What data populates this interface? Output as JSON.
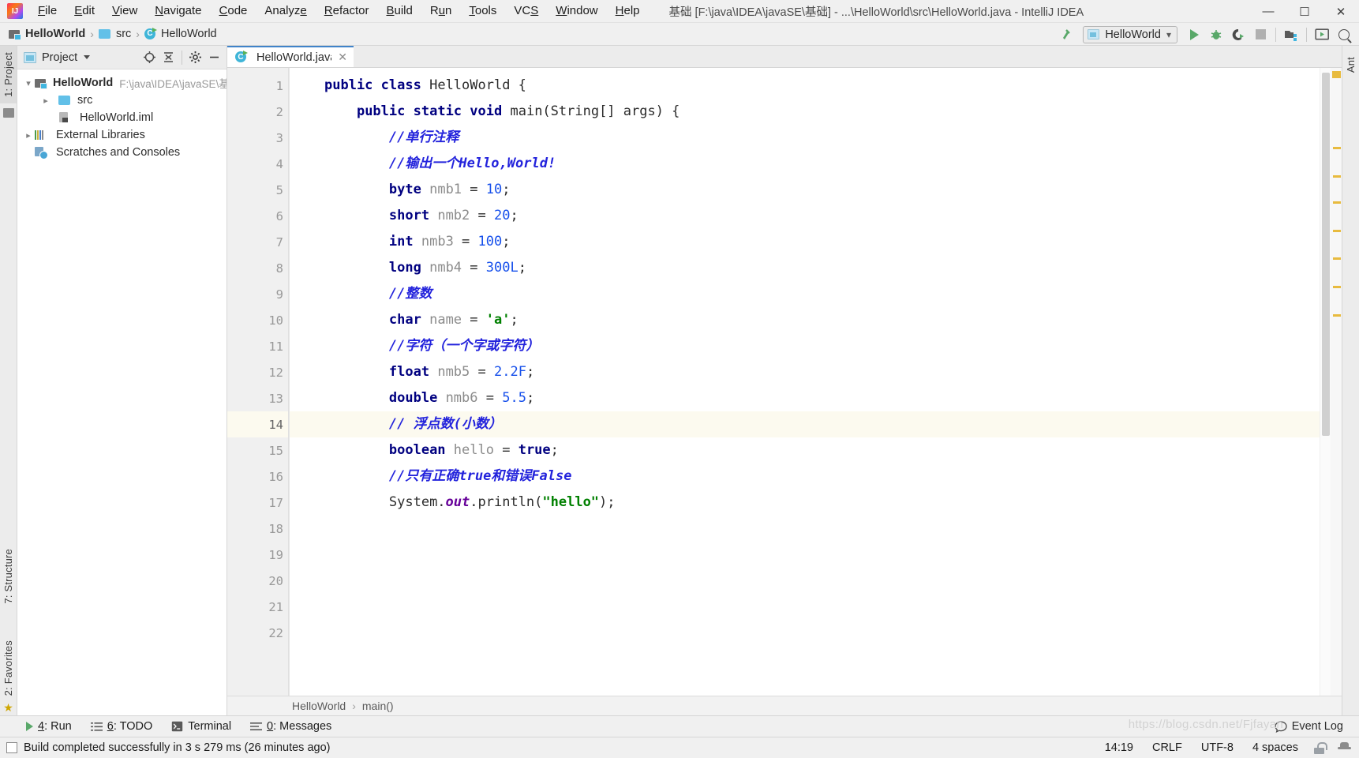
{
  "window": {
    "title": "基础 [F:\\java\\IDEA\\javaSE\\基础] - ...\\HelloWorld\\src\\HelloWorld.java - IntelliJ IDEA",
    "minimize": "—",
    "maximize": "☐",
    "close": "✕"
  },
  "menu": [
    {
      "label": "File"
    },
    {
      "label": "Edit"
    },
    {
      "label": "View"
    },
    {
      "label": "Navigate"
    },
    {
      "label": "Code"
    },
    {
      "label": "Analyze"
    },
    {
      "label": "Refactor"
    },
    {
      "label": "Build"
    },
    {
      "label": "Run"
    },
    {
      "label": "Tools"
    },
    {
      "label": "VCS"
    },
    {
      "label": "Window"
    },
    {
      "label": "Help"
    }
  ],
  "navbar": {
    "crumbs": [
      "HelloWorld",
      "src",
      "HelloWorld"
    ],
    "run_config": "HelloWorld",
    "sep": "›"
  },
  "left_strip": {
    "project_tab": "1: Project",
    "structure_tab": "7: Structure",
    "favorites_tab": "2: Favorites"
  },
  "right_strip": {
    "ant_tab": "Ant"
  },
  "project_panel": {
    "title": "Project",
    "tree": [
      {
        "label": "HelloWorld",
        "path": "F:\\java\\IDEA\\javaSE\\基",
        "icon": "module-icon",
        "arrow": "open",
        "indent": 0,
        "bold": true
      },
      {
        "label": "src",
        "path": "",
        "icon": "folder-icon",
        "arrow": "closed",
        "indent": 1,
        "bold": false
      },
      {
        "label": "HelloWorld.iml",
        "path": "",
        "icon": "iml-file-icon",
        "arrow": "none",
        "indent": 1,
        "bold": false
      },
      {
        "label": "External Libraries",
        "path": "",
        "icon": "library-icon",
        "arrow": "closed",
        "indent": 0,
        "bold": false
      },
      {
        "label": "Scratches and Consoles",
        "path": "",
        "icon": "scratches-icon",
        "arrow": "none",
        "indent": 0,
        "bold": false
      }
    ]
  },
  "editor": {
    "tab": {
      "name": "HelloWorld.java",
      "close": "✕"
    },
    "line_numbers": [
      "1",
      "2",
      "3",
      "4",
      "5",
      "6",
      "7",
      "8",
      "9",
      "10",
      "11",
      "12",
      "13",
      "14",
      "15",
      "16",
      "17",
      "18",
      "19",
      "20",
      "21",
      "22"
    ],
    "current_line": 14,
    "breadcrumb": [
      "HelloWorld",
      "main()"
    ],
    "code": [
      {
        "n": 1,
        "tokens": [
          {
            "t": "public",
            "c": "kw"
          },
          {
            "t": " ",
            "c": "plain"
          },
          {
            "t": "class",
            "c": "kw"
          },
          {
            "t": " HelloWorld {",
            "c": "plain"
          }
        ]
      },
      {
        "n": 2,
        "tokens": [
          {
            "t": "    ",
            "c": "plain"
          },
          {
            "t": "public",
            "c": "kw"
          },
          {
            "t": " ",
            "c": "plain"
          },
          {
            "t": "static",
            "c": "kw"
          },
          {
            "t": " ",
            "c": "plain"
          },
          {
            "t": "void",
            "c": "kw"
          },
          {
            "t": " main(String[] args) {",
            "c": "plain"
          }
        ]
      },
      {
        "n": 3,
        "tokens": [
          {
            "t": "        ",
            "c": "plain"
          },
          {
            "t": "//单行注释",
            "c": "cmt"
          }
        ]
      },
      {
        "n": 4,
        "tokens": [
          {
            "t": "        ",
            "c": "plain"
          },
          {
            "t": "//输出一个Hello,World!",
            "c": "cmt"
          }
        ]
      },
      {
        "n": 5,
        "tokens": [
          {
            "t": "        ",
            "c": "plain"
          },
          {
            "t": "byte",
            "c": "kw"
          },
          {
            "t": " ",
            "c": "plain"
          },
          {
            "t": "nmb1",
            "c": "var"
          },
          {
            "t": " = ",
            "c": "plain"
          },
          {
            "t": "10",
            "c": "num"
          },
          {
            "t": ";",
            "c": "plain"
          }
        ]
      },
      {
        "n": 6,
        "tokens": [
          {
            "t": "        ",
            "c": "plain"
          },
          {
            "t": "short",
            "c": "kw"
          },
          {
            "t": " ",
            "c": "plain"
          },
          {
            "t": "nmb2",
            "c": "var"
          },
          {
            "t": " = ",
            "c": "plain"
          },
          {
            "t": "20",
            "c": "num"
          },
          {
            "t": ";",
            "c": "plain"
          }
        ]
      },
      {
        "n": 7,
        "tokens": [
          {
            "t": "        ",
            "c": "plain"
          },
          {
            "t": "int",
            "c": "kw"
          },
          {
            "t": " ",
            "c": "plain"
          },
          {
            "t": "nmb3",
            "c": "var"
          },
          {
            "t": " = ",
            "c": "plain"
          },
          {
            "t": "100",
            "c": "num"
          },
          {
            "t": ";",
            "c": "plain"
          }
        ]
      },
      {
        "n": 8,
        "tokens": [
          {
            "t": "        ",
            "c": "plain"
          },
          {
            "t": "long",
            "c": "kw"
          },
          {
            "t": " ",
            "c": "plain"
          },
          {
            "t": "nmb4",
            "c": "var"
          },
          {
            "t": " = ",
            "c": "plain"
          },
          {
            "t": "300L",
            "c": "num"
          },
          {
            "t": ";",
            "c": "plain"
          }
        ]
      },
      {
        "n": 9,
        "tokens": [
          {
            "t": "        ",
            "c": "plain"
          },
          {
            "t": "//整数",
            "c": "cmt"
          }
        ]
      },
      {
        "n": 10,
        "tokens": [
          {
            "t": "        ",
            "c": "plain"
          },
          {
            "t": "char",
            "c": "kw"
          },
          {
            "t": " ",
            "c": "plain"
          },
          {
            "t": "name",
            "c": "var"
          },
          {
            "t": " = ",
            "c": "plain"
          },
          {
            "t": "'a'",
            "c": "str"
          },
          {
            "t": ";",
            "c": "plain"
          }
        ]
      },
      {
        "n": 11,
        "tokens": [
          {
            "t": "        ",
            "c": "plain"
          },
          {
            "t": "//字符（一个字或字符）",
            "c": "cmt"
          }
        ]
      },
      {
        "n": 12,
        "tokens": [
          {
            "t": "        ",
            "c": "plain"
          },
          {
            "t": "float",
            "c": "kw"
          },
          {
            "t": " ",
            "c": "plain"
          },
          {
            "t": "nmb5",
            "c": "var"
          },
          {
            "t": " = ",
            "c": "plain"
          },
          {
            "t": "2.2F",
            "c": "num"
          },
          {
            "t": ";",
            "c": "plain"
          }
        ]
      },
      {
        "n": 13,
        "tokens": [
          {
            "t": "        ",
            "c": "plain"
          },
          {
            "t": "double",
            "c": "kw"
          },
          {
            "t": " ",
            "c": "plain"
          },
          {
            "t": "nmb6",
            "c": "var"
          },
          {
            "t": " = ",
            "c": "plain"
          },
          {
            "t": "5.5",
            "c": "num"
          },
          {
            "t": ";",
            "c": "plain"
          }
        ]
      },
      {
        "n": 14,
        "tokens": [
          {
            "t": "        ",
            "c": "plain"
          },
          {
            "t": "// 浮点数(小数）",
            "c": "cmt"
          }
        ]
      },
      {
        "n": 15,
        "tokens": [
          {
            "t": "        ",
            "c": "plain"
          },
          {
            "t": "boolean",
            "c": "kw"
          },
          {
            "t": " ",
            "c": "plain"
          },
          {
            "t": "hello",
            "c": "var"
          },
          {
            "t": " = ",
            "c": "plain"
          },
          {
            "t": "true",
            "c": "kw"
          },
          {
            "t": ";",
            "c": "plain"
          }
        ]
      },
      {
        "n": 16,
        "tokens": [
          {
            "t": "        ",
            "c": "plain"
          },
          {
            "t": "//只有正确true和错误False",
            "c": "cmt"
          }
        ]
      },
      {
        "n": 17,
        "tokens": [
          {
            "t": "        ",
            "c": "plain"
          },
          {
            "t": "System.",
            "c": "plain"
          },
          {
            "t": "out",
            "c": "fld"
          },
          {
            "t": ".println(",
            "c": "plain"
          },
          {
            "t": "\"hello\"",
            "c": "str"
          },
          {
            "t": ");",
            "c": "plain"
          }
        ]
      },
      {
        "n": 18,
        "tokens": []
      },
      {
        "n": 19,
        "tokens": []
      },
      {
        "n": 20,
        "tokens": []
      },
      {
        "n": 21,
        "tokens": []
      },
      {
        "n": 22,
        "tokens": []
      }
    ]
  },
  "bottom_tools": [
    {
      "num": "4",
      "label": ": Run",
      "icon": "run-icon"
    },
    {
      "num": "6",
      "label": ": TODO",
      "icon": "todo-icon"
    },
    {
      "num": "",
      "label": "Terminal",
      "icon": "terminal-icon"
    },
    {
      "num": "0",
      "label": ": Messages",
      "icon": "messages-icon"
    }
  ],
  "event_log": "Event Log",
  "status": {
    "message": "Build completed successfully in 3 s 279 ms (26 minutes ago)",
    "time": "14:19",
    "line_separator": "CRLF",
    "encoding": "UTF-8",
    "indent": "4 spaces"
  },
  "watermark": "https://blog.csdn.net/Fjfayan",
  "colors": {
    "accent_blue": "#4083c9",
    "green_run": "#59a869",
    "keyword": "#000080",
    "comment": "#2323dc",
    "string": "#008000",
    "number": "#1750eb",
    "current_line": "#fcfaef",
    "marker_yellow": "#e8bb3f"
  }
}
